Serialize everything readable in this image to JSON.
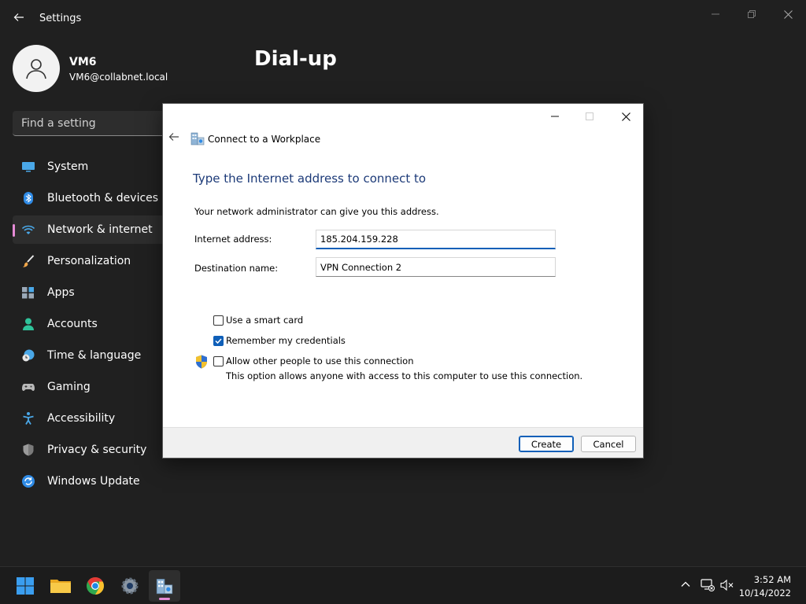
{
  "window": {
    "title": "Settings",
    "back_icon": "arrow-left-icon",
    "minimize_icon": "minimize-icon",
    "maximize_icon": "restore-icon",
    "close_icon": "close-icon"
  },
  "profile": {
    "name": "VM6",
    "email": "VM6@collabnet.local",
    "avatar_icon": "user-icon"
  },
  "search": {
    "placeholder": "Find a setting"
  },
  "sidebar": {
    "items": [
      {
        "label": "System",
        "icon": "monitor-icon",
        "active": false
      },
      {
        "label": "Bluetooth & devices",
        "icon": "bluetooth-icon",
        "active": false
      },
      {
        "label": "Network & internet",
        "icon": "wifi-icon",
        "active": true
      },
      {
        "label": "Personalization",
        "icon": "brush-icon",
        "active": false
      },
      {
        "label": "Apps",
        "icon": "apps-icon",
        "active": false
      },
      {
        "label": "Accounts",
        "icon": "person-icon",
        "active": false
      },
      {
        "label": "Time & language",
        "icon": "clock-globe-icon",
        "active": false
      },
      {
        "label": "Gaming",
        "icon": "gamepad-icon",
        "active": false
      },
      {
        "label": "Accessibility",
        "icon": "accessibility-icon",
        "active": false
      },
      {
        "label": "Privacy & security",
        "icon": "shield-icon",
        "active": false
      },
      {
        "label": "Windows Update",
        "icon": "update-icon",
        "active": false
      }
    ]
  },
  "main": {
    "title": "Dial-up"
  },
  "dialog": {
    "app_title": "Connect to a Workplace",
    "heading": "Type the Internet address to connect to",
    "description": "Your network administrator can give you this address.",
    "internet_address_label": "Internet address:",
    "internet_address_value": "185.204.159.228",
    "destination_name_label": "Destination name:",
    "destination_name_value": "VPN Connection 2",
    "options": {
      "smart_card": {
        "label": "Use a smart card",
        "checked": false
      },
      "remember_credentials": {
        "label": "Remember my credentials",
        "checked": true
      },
      "allow_others": {
        "label": "Allow other people to use this connection",
        "checked": false,
        "hint": "This option allows anyone with access to this computer to use this connection."
      }
    },
    "create_label": "Create",
    "cancel_label": "Cancel",
    "colors": {
      "heading": "#1c3a78",
      "accent": "#0f5fb8"
    }
  },
  "taskbar": {
    "apps": [
      {
        "name": "start",
        "icon": "windows-start-icon"
      },
      {
        "name": "file-explorer",
        "icon": "folder-icon"
      },
      {
        "name": "chrome",
        "icon": "chrome-icon"
      },
      {
        "name": "settings",
        "icon": "gear-icon"
      },
      {
        "name": "connect-workplace",
        "icon": "workplace-icon",
        "active": true
      }
    ],
    "tray": {
      "overflow_icon": "chevron-up-icon",
      "network_icon": "network-disconnected-icon",
      "volume_icon": "volume-muted-icon"
    },
    "clock": {
      "time": "3:52 AM",
      "date": "10/14/2022"
    }
  },
  "accent_color": "#e58bd6"
}
